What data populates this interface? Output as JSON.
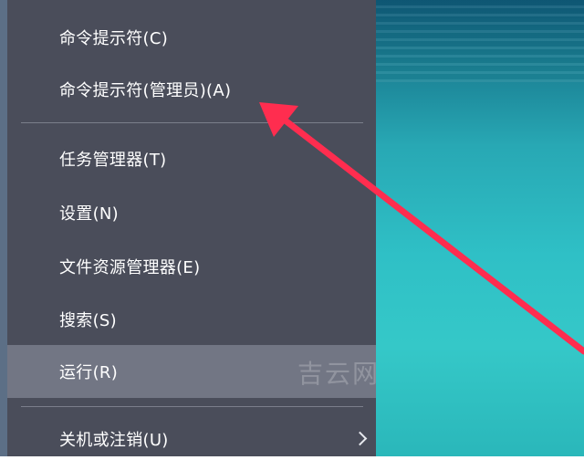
{
  "menu": {
    "items": [
      {
        "label": "命令提示符(C)"
      },
      {
        "label": "命令提示符(管理员)(A)"
      },
      {
        "label": "任务管理器(T)"
      },
      {
        "label": "设置(N)"
      },
      {
        "label": "文件资源管理器(E)"
      },
      {
        "label": "搜索(S)"
      },
      {
        "label": "运行(R)",
        "selected": true
      },
      {
        "label": "关机或注销(U)",
        "submenu": true
      }
    ]
  },
  "annotation": {
    "arrow_color": "#ff2d4f",
    "watermark": "吉云网"
  },
  "colors": {
    "menu_bg": "#4a4d5a",
    "menu_selected": "#727684",
    "separator": "#7b7f8b",
    "text": "#ffffff"
  }
}
